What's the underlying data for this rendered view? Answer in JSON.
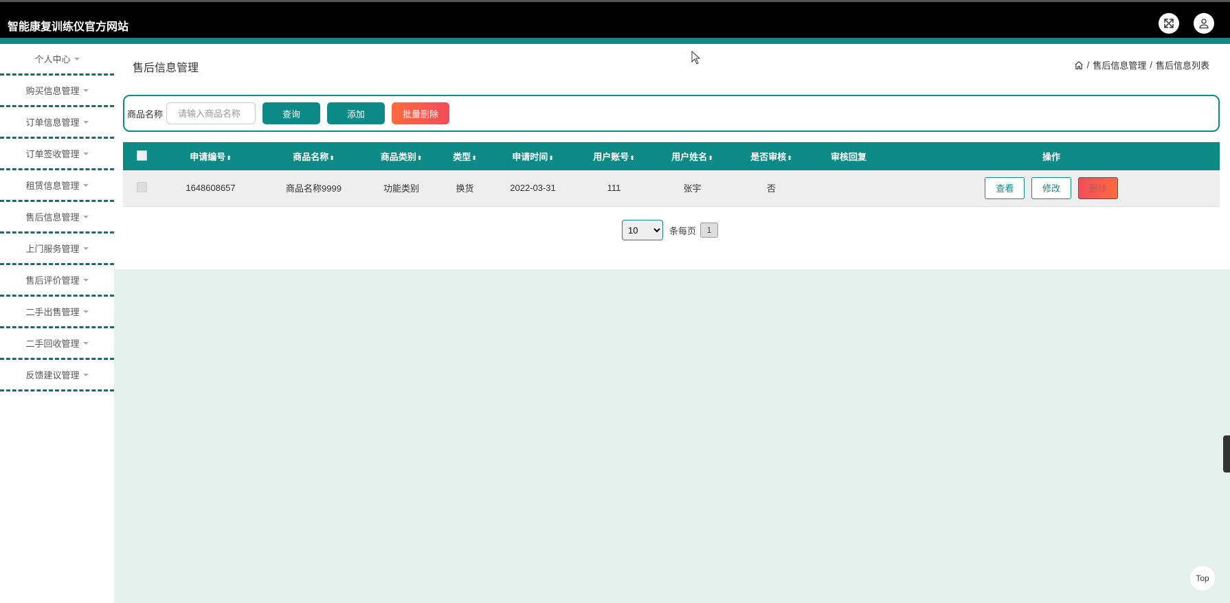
{
  "header": {
    "site_title": "智能康复训练仪官方网站",
    "fullscreen_icon": "expand-icon",
    "user_icon": "user-icon"
  },
  "sidebar": {
    "items": [
      {
        "label": "个人中心"
      },
      {
        "label": "购买信息管理"
      },
      {
        "label": "订单信息管理"
      },
      {
        "label": "订单签收管理"
      },
      {
        "label": "租赁信息管理"
      },
      {
        "label": "售后信息管理"
      },
      {
        "label": "上门服务管理"
      },
      {
        "label": "售后评价管理"
      },
      {
        "label": "二手出售管理"
      },
      {
        "label": "二手回收管理"
      },
      {
        "label": "反馈建议管理"
      }
    ]
  },
  "main": {
    "page_title": "售后信息管理",
    "breadcrumb": {
      "home_icon": "home-icon",
      "items": [
        "售后信息管理",
        "售后信息列表"
      ],
      "separator": "/"
    },
    "search": {
      "label": "商品名称",
      "placeholder": "请输入商品名称",
      "value": "",
      "query_label": "查询",
      "add_label": "添加",
      "batch_delete_label": "批量删除"
    },
    "table": {
      "headers": [
        "申请编号",
        "商品名称",
        "商品类别",
        "类型",
        "申请时间",
        "用户账号",
        "用户姓名",
        "是否审核",
        "审核回复",
        "操作"
      ],
      "rows": [
        {
          "cells": [
            "1648608657",
            "商品名称9999",
            "功能类别",
            "换货",
            "2022-03-31",
            "111",
            "张宇",
            "否",
            ""
          ],
          "actions": {
            "view": "查看",
            "edit": "修改",
            "delete": "删除"
          }
        }
      ]
    },
    "pagination": {
      "page_size": "10",
      "page_size_options": [
        "10"
      ],
      "per_page_label": "条每页",
      "current_page": "1"
    }
  },
  "top_button_label": "Top",
  "colors": {
    "accent": "#0d8a86",
    "danger": "#f24c5a",
    "content_bg": "#e4f1ec"
  }
}
